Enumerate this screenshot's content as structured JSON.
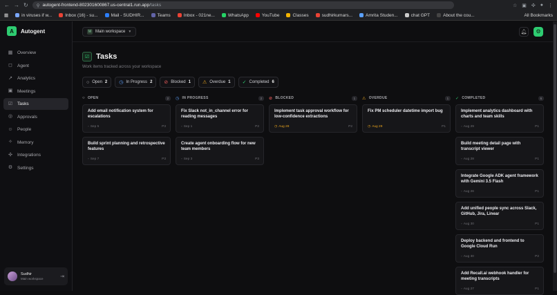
{
  "browser": {
    "url_host": "autogent-frontend-802301600867.us-central1.run.app",
    "url_path": "/tasks",
    "bookmarks": [
      {
        "label": "in viruses if w...",
        "color": "#7aa7ff"
      },
      {
        "label": "Inbox (16) - su...",
        "color": "#ea4335"
      },
      {
        "label": "Mail - SUDHIR...",
        "color": "#2d7ff9"
      },
      {
        "label": "Teams",
        "color": "#6264a7"
      },
      {
        "label": "Inbox - 021ne...",
        "color": "#ea4335"
      },
      {
        "label": "WhatsApp",
        "color": "#25d366"
      },
      {
        "label": "YouTube",
        "color": "#ff0000"
      },
      {
        "label": "Classes",
        "color": "#f4b400"
      },
      {
        "label": "sudhirkumars...",
        "color": "#ea4335"
      },
      {
        "label": "Amrita Studen...",
        "color": "#5aa0ff"
      },
      {
        "label": "chat GPT",
        "color": "#cccccc"
      },
      {
        "label": "About the cou...",
        "color": "#444444"
      }
    ],
    "all_bookmarks": "All Bookmarks"
  },
  "sidebar": {
    "brand": "Autogent",
    "brand_letter": "A",
    "items": [
      {
        "label": "Overview",
        "icon": "grid-icon",
        "glyph": "▦"
      },
      {
        "label": "Agent",
        "icon": "chat-icon",
        "glyph": "◻"
      },
      {
        "label": "Analytics",
        "icon": "chart-icon",
        "glyph": "↗"
      },
      {
        "label": "Meetings",
        "icon": "calendar-icon",
        "glyph": "▣"
      },
      {
        "label": "Tasks",
        "icon": "check-square-icon",
        "glyph": "☑"
      },
      {
        "label": "Approvals",
        "icon": "shield-icon",
        "glyph": "◎"
      },
      {
        "label": "People",
        "icon": "people-icon",
        "glyph": "☺"
      },
      {
        "label": "Memory",
        "icon": "brain-icon",
        "glyph": "✧"
      },
      {
        "label": "Integrations",
        "icon": "plug-icon",
        "glyph": "✣"
      },
      {
        "label": "Settings",
        "icon": "gear-icon",
        "glyph": "⚙"
      }
    ],
    "active_index": 4,
    "user": {
      "name": "Sudhir",
      "workspace": "Main workspace"
    }
  },
  "topbar": {
    "workspace": "Main workspace",
    "workspace_letter": "M"
  },
  "page": {
    "title": "Tasks",
    "subtitle": "Work items tracked across your workspace"
  },
  "filters": [
    {
      "label": "Open",
      "count": "2",
      "icon": "circle-icon",
      "glyph": "○",
      "color": "#bdbdc2"
    },
    {
      "label": "In Progress",
      "count": "2",
      "icon": "clock-icon",
      "glyph": "◷",
      "color": "#5b9cf5"
    },
    {
      "label": "Blocked",
      "count": "1",
      "icon": "blocked-icon",
      "glyph": "⊘",
      "color": "#e85a5a"
    },
    {
      "label": "Overdue",
      "count": "1",
      "icon": "warning-icon",
      "glyph": "⚠",
      "color": "#e8a41d"
    },
    {
      "label": "Completed",
      "count": "6",
      "icon": "check-circle-icon",
      "glyph": "✓",
      "color": "#2ecc71"
    }
  ],
  "columns": [
    {
      "title": "OPEN",
      "count": "2",
      "glyph": "○",
      "color": "#bdbdc2",
      "icon": "circle-icon",
      "cards": [
        {
          "title": "Add email notification system for escalations",
          "date": "Sep 5",
          "priority": "P3"
        },
        {
          "title": "Build sprint planning and retrospective features",
          "date": "Sep 7",
          "priority": "P3"
        }
      ]
    },
    {
      "title": "IN PROGRESS",
      "count": "2",
      "glyph": "◷",
      "color": "#5b9cf5",
      "icon": "clock-icon",
      "cards": [
        {
          "title": "Fix Slack not_in_channel error for reading messages",
          "date": "Sep 1",
          "priority": "P2"
        },
        {
          "title": "Create agent onboarding flow for new team members",
          "date": "Sep 3",
          "priority": "P3"
        }
      ]
    },
    {
      "title": "BLOCKED",
      "count": "1",
      "glyph": "⊘",
      "color": "#e85a5a",
      "icon": "blocked-icon",
      "cards": [
        {
          "title": "Implement task approval workflow for low-confidence extractions",
          "date": "Aug 28",
          "priority": "P2",
          "overdue": true
        }
      ]
    },
    {
      "title": "OVERDUE",
      "count": "1",
      "glyph": "⚠",
      "color": "#e8a41d",
      "icon": "warning-icon",
      "cards": [
        {
          "title": "Fix PM scheduler datetime import bug",
          "date": "Aug 29",
          "priority": "P1",
          "overdue": true
        }
      ]
    },
    {
      "title": "COMPLETED",
      "count": "6",
      "glyph": "✓",
      "color": "#2ecc71",
      "icon": "check-circle-icon",
      "cards": [
        {
          "title": "Implement analytics dashboard with charts and team skills",
          "date": "Aug 29",
          "priority": "P1"
        },
        {
          "title": "Build meeting detail page with transcript viewer",
          "date": "Aug 28",
          "priority": "P1"
        },
        {
          "title": "Integrate Google ADK agent framework with Gemini 3.5 Flash",
          "date": "Aug 26",
          "priority": "P1"
        },
        {
          "title": "Add unified people sync across Slack, GitHub, Jira, Linear",
          "date": "Aug 30",
          "priority": "P1"
        },
        {
          "title": "Deploy backend and frontend to Google Cloud Run",
          "date": "Aug 30",
          "priority": "P2"
        },
        {
          "title": "Add Recall.ai webhook handler for meeting transcripts",
          "date": "Aug 27",
          "priority": "P1"
        }
      ]
    }
  ]
}
